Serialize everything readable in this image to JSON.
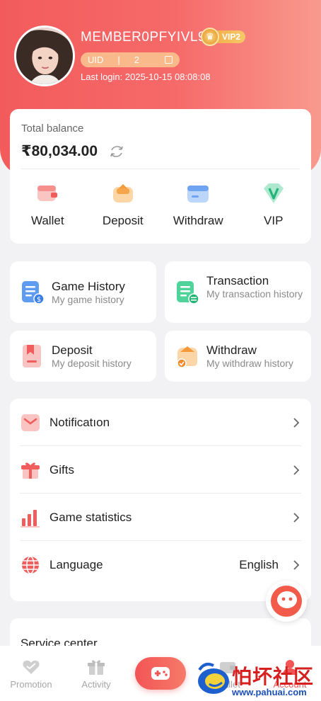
{
  "header": {
    "member_name": "MEMBER0PFYIVL9",
    "vip_level": "VIP2",
    "uid_label": "UID",
    "uid_separator": "|",
    "uid_value": "2",
    "last_login": "Last login: 2025-10-15 08:08:08"
  },
  "balance": {
    "label": "Total balance",
    "value": "₹80,034.00"
  },
  "actions": [
    {
      "label": "Wallet",
      "icon": "wallet-icon"
    },
    {
      "label": "Deposit",
      "icon": "deposit-icon"
    },
    {
      "label": "Withdraw",
      "icon": "withdraw-icon"
    },
    {
      "label": "VIP",
      "icon": "vip-icon"
    }
  ],
  "history": {
    "game": {
      "title": "Game History",
      "subtitle": "My game history"
    },
    "transaction": {
      "title": "Transaction",
      "subtitle": "My transaction history"
    },
    "deposit": {
      "title": "Deposit",
      "subtitle": "My deposit history"
    },
    "withdraw": {
      "title": "Withdraw",
      "subtitle": "My withdraw history"
    }
  },
  "menu": {
    "notification": "Notificatıon",
    "gifts": "Gifts",
    "game_statistics": "Game statistics",
    "language": "Language",
    "language_value": "English"
  },
  "service": {
    "title": "Service center"
  },
  "nav": {
    "promotion": "Promotion",
    "activity": "Activity",
    "wallet": "Wallet",
    "account": "Account"
  },
  "watermark": {
    "text": "怕坏社区",
    "url": "www.pahuai.com"
  },
  "colors": {
    "brand": "#f35b5b",
    "accent_gold": "#f2b04a"
  }
}
